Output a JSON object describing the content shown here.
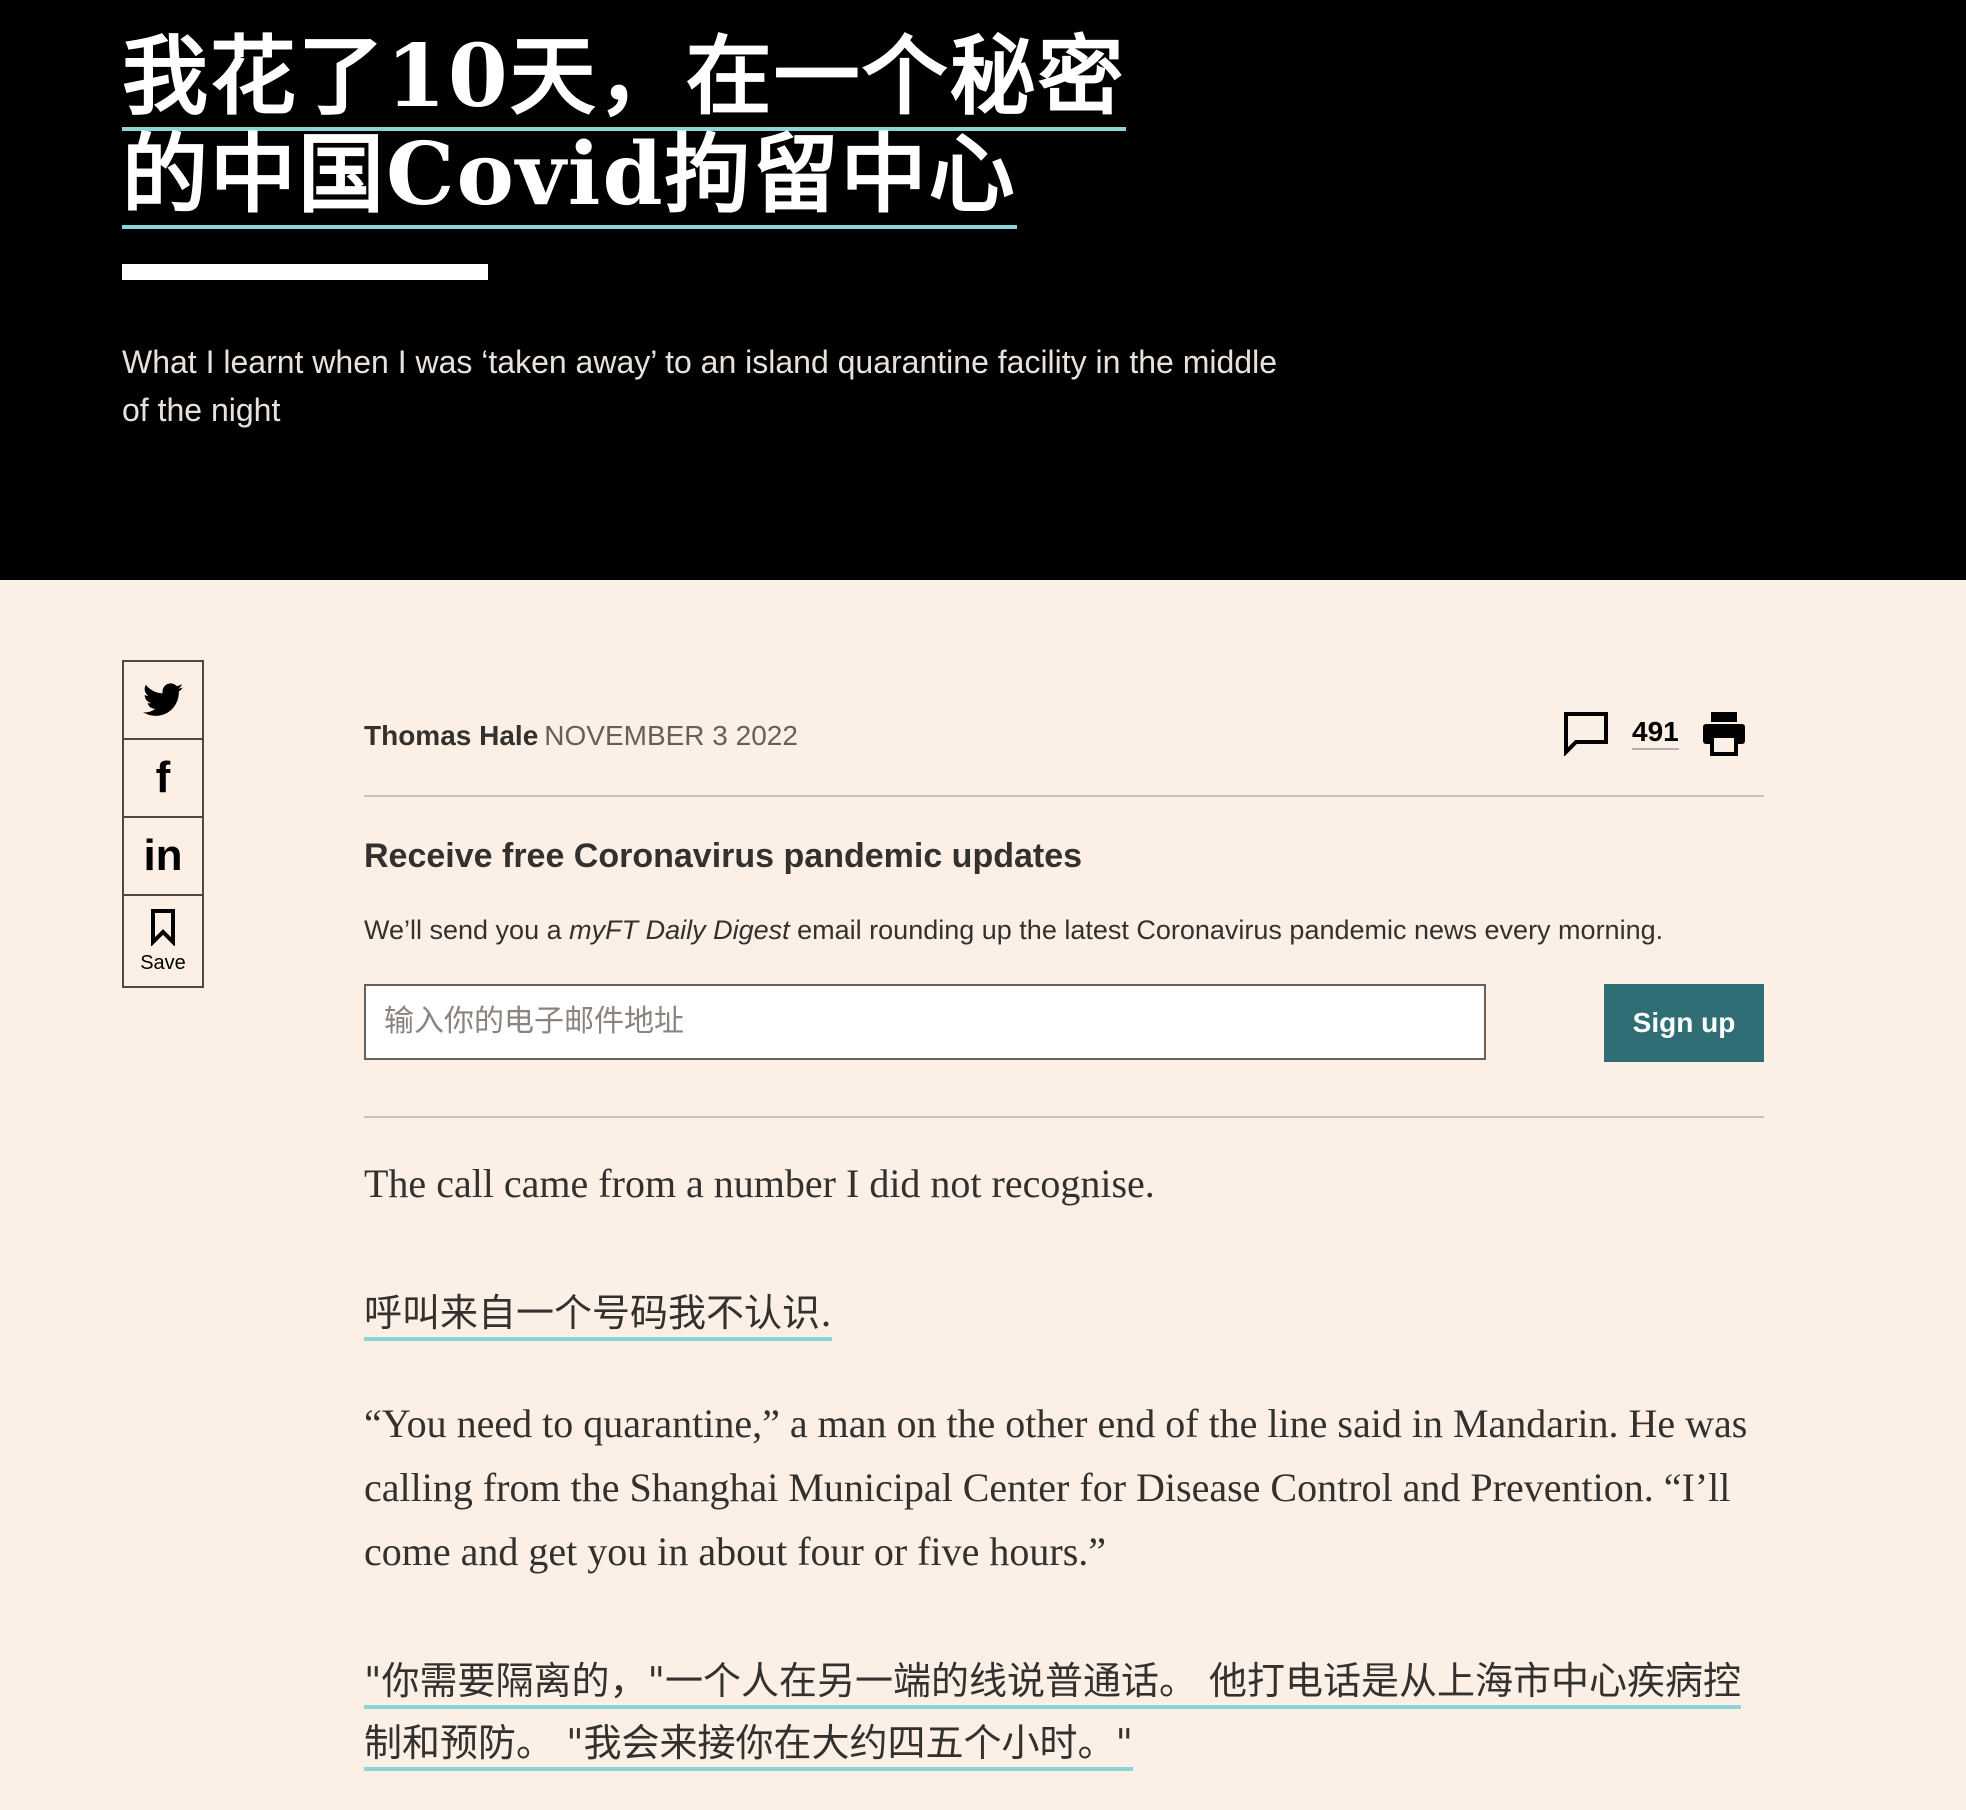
{
  "headline": {
    "title": "我花了10天，在一个秘密的中国Covid拘留中心",
    "standfirst": "What I learnt when I was ‘taken away’ to an island quarantine facility in the middle of the night"
  },
  "share": {
    "twitter_icon": "twitter-icon",
    "facebook_icon": "facebook-icon",
    "linkedin_icon": "linkedin-icon",
    "save_icon": "bookmark-icon",
    "save_label": "Save"
  },
  "byline": {
    "author": "Thomas Hale",
    "date": "NOVEMBER 3 2022",
    "comment_count": "491"
  },
  "signup": {
    "title": "Receive free Coronavirus pandemic updates",
    "text_before": "We’ll send you a ",
    "text_italic": "myFT Daily Digest",
    "text_after": " email rounding up the latest Coronavirus pandemic news every morning.",
    "placeholder": "输入你的电子邮件地址",
    "button": "Sign up"
  },
  "article": {
    "p1_en": "The call came from a number I did not recognise.",
    "p1_zh": "呼叫来自一个号码我不认识.",
    "p2_en": "“You need to quarantine,” a man on the other end of the line said in Mandarin. He was calling from the Shanghai Municipal Center for Disease Control and Prevention. “I’ll come and get you in about four or five hours.”",
    "p2_zh": "\"你需要隔离的，\"一个人在另一端的线说普通话。 他打电话是从上海市中心疾病控制和预防。 \"我会来接你在大约四五个小时。\""
  },
  "colors": {
    "page_bg": "#fcf0e6",
    "accent_teal": "#2e6e74",
    "translation_underline": "#8ad5d8"
  }
}
